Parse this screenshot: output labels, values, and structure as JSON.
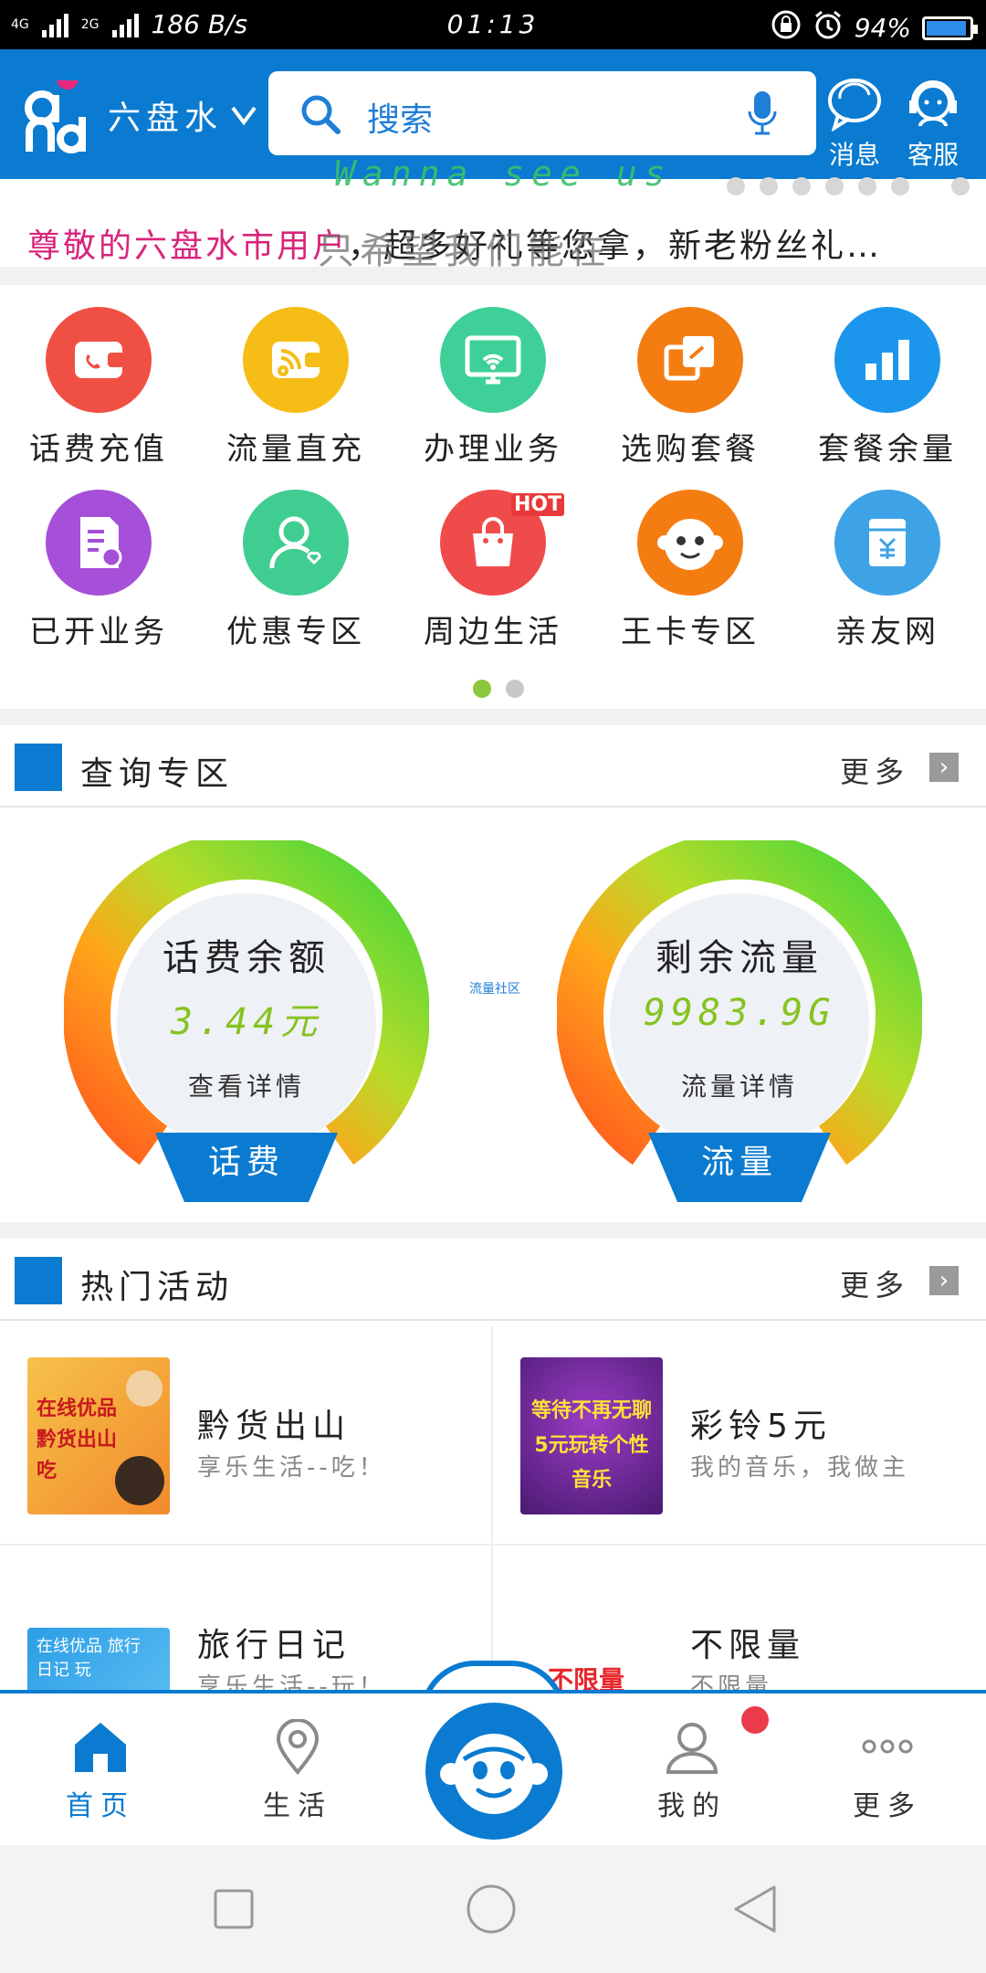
{
  "status_bar": {
    "network_left": "4G",
    "network_right": "2G",
    "speed": "186 B/s",
    "time": "01:13",
    "battery": "94%",
    "battery_level": 0.94
  },
  "header": {
    "city": "六盘水",
    "search_placeholder": "搜索",
    "messages_label": "消息",
    "service_label": "客服"
  },
  "notice": {
    "highlight": "尊敬的六盘水市用户",
    "text": "，超多好礼等您拿，新老粉丝礼…",
    "overlay_en": "Wanna see us",
    "overlay_cn": "只希望我们能在"
  },
  "grid": {
    "items": [
      {
        "label": "话费充值",
        "icon": "wallet-phone-icon",
        "color": "#f04f43"
      },
      {
        "label": "流量直充",
        "icon": "wallet-wifi-icon",
        "color": "#f6bd16"
      },
      {
        "label": "办理业务",
        "icon": "monitor-icon",
        "color": "#3ed098"
      },
      {
        "label": "选购套餐",
        "icon": "package-icon",
        "color": "#f47d12"
      },
      {
        "label": "套餐余量",
        "icon": "bar-chart-icon",
        "color": "#1c96ec"
      },
      {
        "label": "已开业务",
        "icon": "document-icon",
        "color": "#a64fd8"
      },
      {
        "label": "优惠专区",
        "icon": "user-heart-icon",
        "color": "#40cd91"
      },
      {
        "label": "周边生活",
        "icon": "shopping-bag-icon",
        "color": "#f04b4b",
        "badge": "HOT"
      },
      {
        "label": "王卡专区",
        "icon": "monkey-icon",
        "color": "#f47d12"
      },
      {
        "label": "亲友网",
        "icon": "yuan-card-icon",
        "color": "#3ea3e6"
      }
    ]
  },
  "query_section": {
    "title": "查询专区",
    "more": "更多",
    "fee": {
      "title": "话费余额",
      "value": "3.44元",
      "link": "查看详情",
      "tab": "话费"
    },
    "data": {
      "title": "剩余流量",
      "value": "9983.9G",
      "link": "流量详情",
      "tab": "流量"
    },
    "community_link": "流量社区"
  },
  "hot_section": {
    "title": "热门活动",
    "more": "更多",
    "items": [
      {
        "name": "黔货出山",
        "desc": "享乐生活--吃！",
        "image_text": "在线优品 黔货出山 吃"
      },
      {
        "name": "彩铃5元",
        "desc": "我的音乐，我做主",
        "image_text": "等待不再无聊 5元玩转个性音乐"
      },
      {
        "name": "旅行日记",
        "desc": "享乐生活--玩！",
        "image_text": "在线优品 旅行日记 玩"
      },
      {
        "name": "不限量",
        "desc": "不限量",
        "image_text": "不限量"
      }
    ]
  },
  "tabbar": {
    "home": "首页",
    "life": "生活",
    "mine": "我的",
    "more": "更多"
  }
}
